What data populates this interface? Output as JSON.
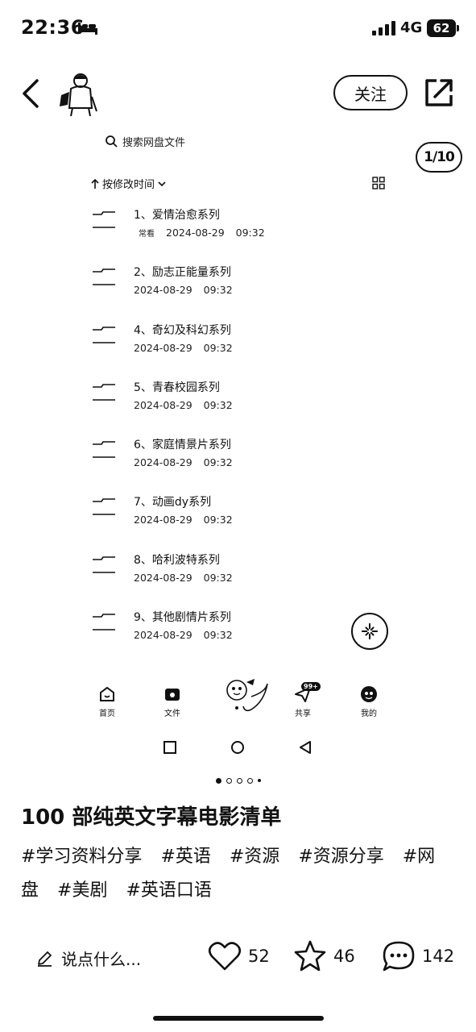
{
  "status_bar": {
    "time": "22:36",
    "network": "4G",
    "battery": "62"
  },
  "top_nav": {
    "follow_label": "关注"
  },
  "embedded_screen": {
    "search_placeholder": "搜索网盘文件",
    "page_counter": "1/10",
    "sort_label": "按修改时间",
    "files": [
      {
        "name": "1、爱情治愈系列",
        "tag": "常看",
        "date": "2024-08-29",
        "time": "09:32"
      },
      {
        "name": "2、励志正能量系列",
        "tag": "",
        "date": "2024-08-29",
        "time": "09:32"
      },
      {
        "name": "4、奇幻及科幻系列",
        "tag": "",
        "date": "2024-08-29",
        "time": "09:32"
      },
      {
        "name": "5、青春校园系列",
        "tag": "",
        "date": "2024-08-29",
        "time": "09:32"
      },
      {
        "name": "6、家庭情景片系列",
        "tag": "",
        "date": "2024-08-29",
        "time": "09:32"
      },
      {
        "name": "7、动画dy系列",
        "tag": "",
        "date": "2024-08-29",
        "time": "09:32"
      },
      {
        "name": "8、哈利波特系列",
        "tag": "",
        "date": "2024-08-29",
        "time": "09:32"
      },
      {
        "name": "9、其他剧情片系列",
        "tag": "",
        "date": "2024-08-29",
        "time": "09:32"
      }
    ],
    "tabs": [
      {
        "label": "首页",
        "icon": "home-icon"
      },
      {
        "label": "文件",
        "icon": "folder-icon"
      },
      {
        "label": "共享",
        "icon": "send-icon",
        "badge": "99+"
      },
      {
        "label": "我的",
        "icon": "profile-icon"
      }
    ]
  },
  "post": {
    "title": "100 部纯英文字幕电影清单",
    "hashtags": [
      "#学习资料分享",
      "#英语",
      "#资源",
      "#资源分享",
      "#网盘",
      "#美剧",
      "#英语口语"
    ]
  },
  "actions": {
    "comment_placeholder": "说点什么...",
    "likes": "52",
    "favorites": "46",
    "comments": "142"
  }
}
